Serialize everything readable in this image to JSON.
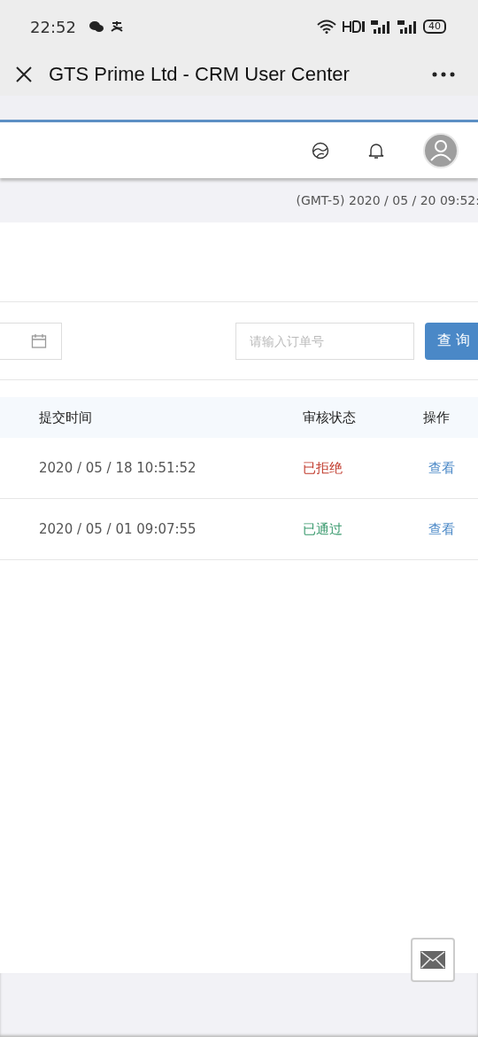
{
  "status_bar": {
    "time": "22:52",
    "battery": "40"
  },
  "browser": {
    "title": "GTS Prime Ltd - CRM User Center"
  },
  "timestamp": "(GMT-5) 2020 / 05 / 20 09:52:",
  "filter": {
    "order_placeholder": "请输入订单号",
    "search_button": "查 询"
  },
  "table": {
    "columns": [
      "提交时间",
      "审核状态",
      "操作"
    ],
    "rows": [
      {
        "time": "2020 / 05 / 18 10:51:52",
        "status": "已拒绝",
        "color": "#c0392b",
        "action": "查看"
      },
      {
        "time": "2020 / 05 / 01 09:07:55",
        "status": "已通过",
        "color": "#3a9a6e",
        "action": "查看"
      }
    ]
  }
}
